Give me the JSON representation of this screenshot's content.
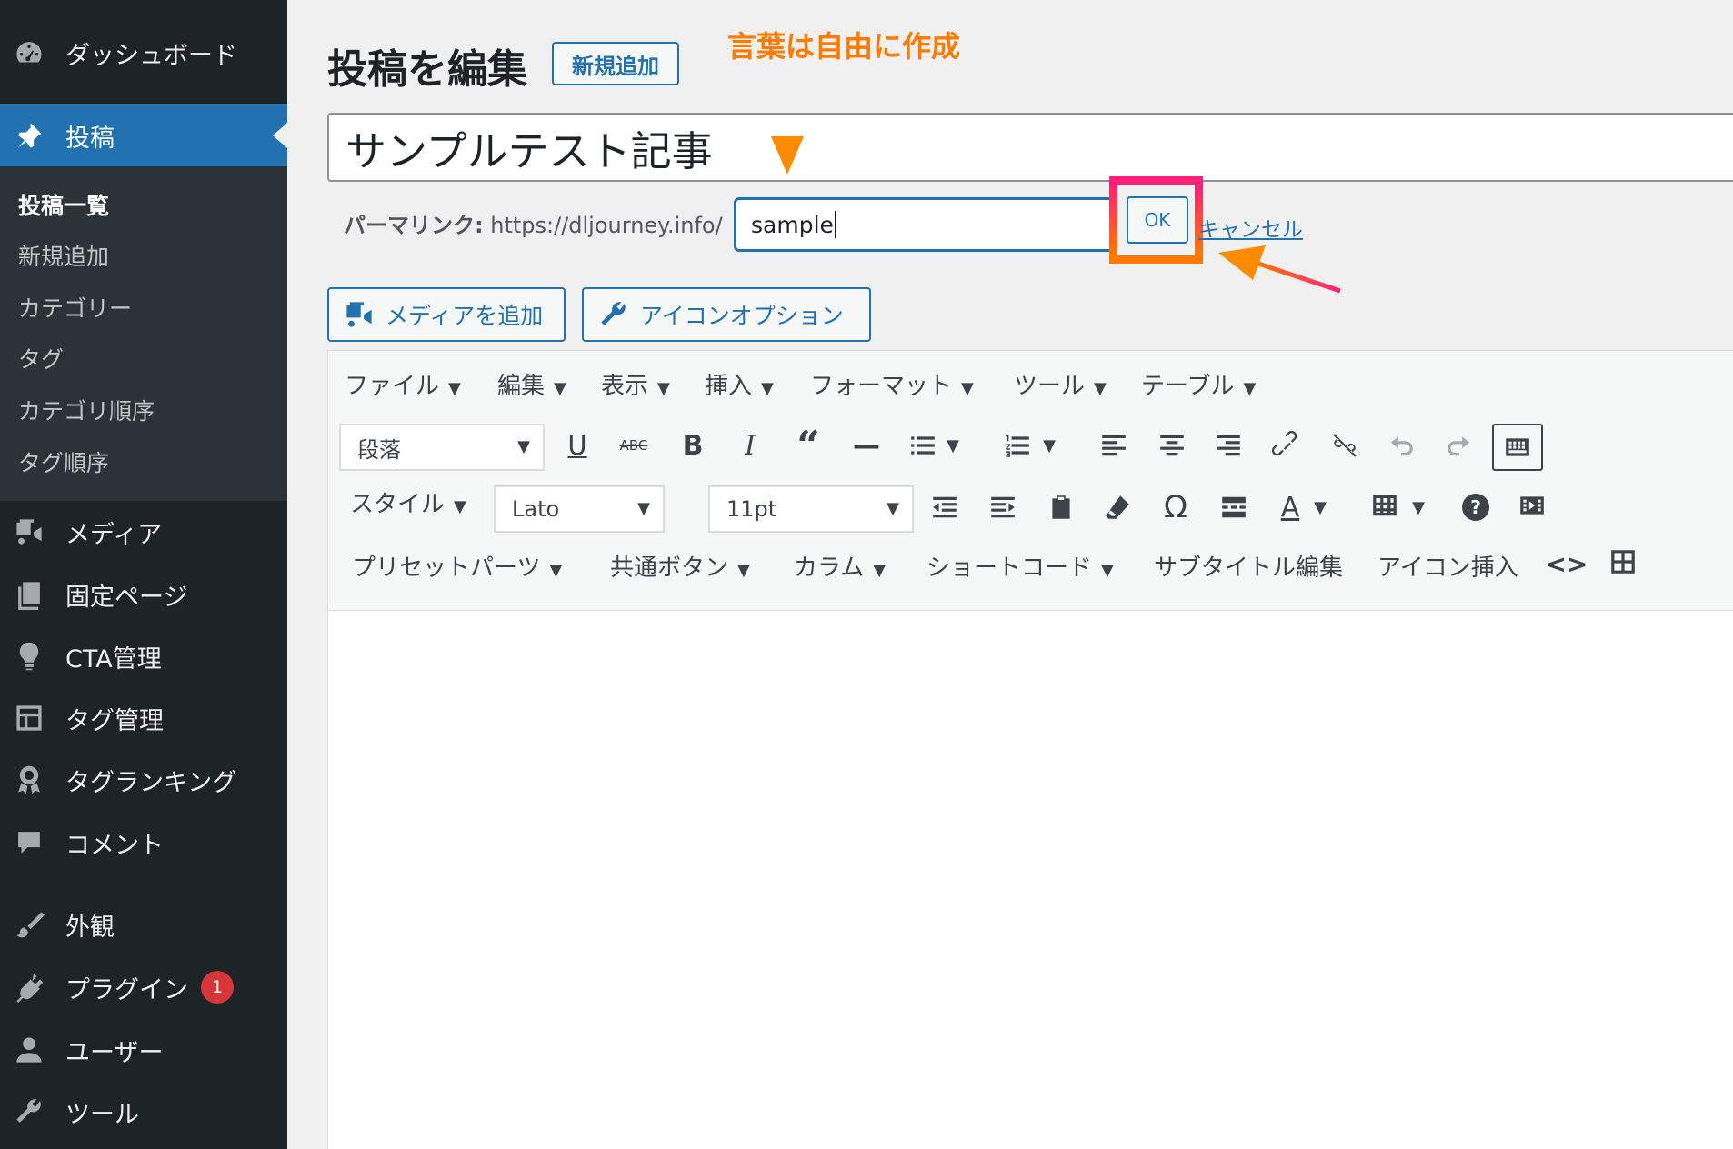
{
  "sidebar": {
    "items": [
      {
        "label": "ダッシュボード",
        "icon": "dashboard-icon"
      },
      {
        "label": "投稿",
        "icon": "pin-icon"
      },
      {
        "label": "メディア",
        "icon": "media-icon"
      },
      {
        "label": "固定ページ",
        "icon": "page-icon"
      },
      {
        "label": "CTA管理",
        "icon": "lightbulb-icon"
      },
      {
        "label": "タグ管理",
        "icon": "layout-icon"
      },
      {
        "label": "タグランキング",
        "icon": "award-icon"
      },
      {
        "label": "コメント",
        "icon": "comment-icon"
      },
      {
        "label": "外観",
        "icon": "brush-icon"
      },
      {
        "label": "プラグイン",
        "icon": "plugin-icon",
        "badge": "1"
      },
      {
        "label": "ユーザー",
        "icon": "user-icon"
      },
      {
        "label": "ツール",
        "icon": "wrench-icon"
      }
    ],
    "submenu": [
      "投稿一覧",
      "新規追加",
      "カテゴリー",
      "タグ",
      "カテゴリ順序",
      "タグ順序"
    ]
  },
  "header": {
    "title": "投稿を編集",
    "add_new": "新規追加"
  },
  "annotation": {
    "text": "言葉は自由に作成",
    "color": "#ff7a00",
    "highlight_color": "#ff1f7a"
  },
  "post": {
    "title": "サンプルテスト記事"
  },
  "permalink": {
    "label": "パーマリンク:",
    "base_url": "https://dljourney.info/",
    "slug": "sample",
    "ok": "OK",
    "cancel": "キャンセル"
  },
  "buttons": {
    "add_media": "メディアを追加",
    "icon_option": "アイコンオプション"
  },
  "editor": {
    "menubar": [
      "ファイル",
      "編集",
      "表示",
      "挿入",
      "フォーマット",
      "ツール",
      "テーブル"
    ],
    "format_select": "段落",
    "style_label": "スタイル",
    "font_select": "Lato",
    "size_select": "11pt",
    "row3": [
      "プリセットパーツ",
      "共通ボタン",
      "カラム",
      "ショートコード"
    ],
    "row3_plain": [
      "サブタイトル編集",
      "アイコン挿入"
    ],
    "glyphs": {
      "underline": "U",
      "strike": "ABC",
      "bold": "B",
      "italic": "I",
      "quote": "“",
      "hr": "—",
      "omega": "Ω",
      "textcolor": "A",
      "help": "?",
      "code": "<>"
    }
  },
  "colors": {
    "sidebar": "#1d2327",
    "accent": "#2271b1",
    "badge": "#d63638"
  }
}
